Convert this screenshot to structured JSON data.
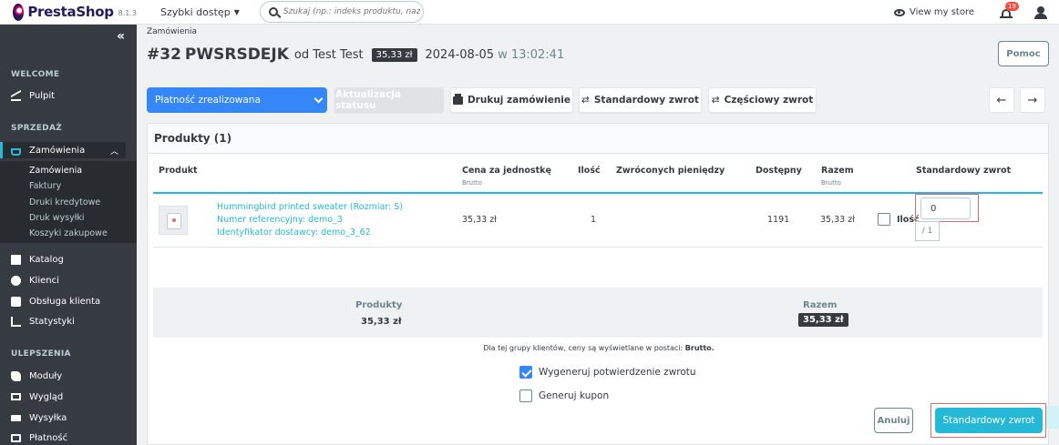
{
  "topbar": {
    "logo": "PrestaShop",
    "version": "8.1.3",
    "quick_access": "Szybki dostęp",
    "search_placeholder": "Szukaj (np.: indeks produktu, nazwa k",
    "view_store": "View my store",
    "notifications_count": "19"
  },
  "sidebar": {
    "collapse": "«",
    "sections": {
      "welcome": "WELCOME",
      "sales": "SPRZEDAŻ",
      "improvements": "ULEPSZENIA"
    },
    "items": {
      "dashboard": "Pulpit",
      "orders": "Zamówienia",
      "catalog": "Katalog",
      "customers": "Klienci",
      "service": "Obsługa klienta",
      "stats": "Statystyki",
      "modules": "Moduły",
      "design": "Wygląd",
      "shipping": "Wysyłka",
      "payment": "Płatność"
    },
    "orders_sub": [
      "Zamówienia",
      "Faktury",
      "Druki kredytowe",
      "Druk wysyłki",
      "Koszyki zakupowe"
    ]
  },
  "header": {
    "breadcrumb": "Zamówienia",
    "order_number": "#32",
    "order_ref": "PWSRSDEJK",
    "by_customer": "od Test Test",
    "total": "35,33 zł",
    "date": "2024-08-05",
    "time": "w 13:02:41",
    "help": "Pomoc"
  },
  "toolbar": {
    "status": "Płatność zrealizowana",
    "update_status": "Aktualizacja statusu",
    "print": "Drukuj zamówienie",
    "standard_refund": "Standardowy zwrot",
    "partial_refund": "Częściowy zwrot",
    "prev": "←",
    "next": "→"
  },
  "products": {
    "title": "Produkty (1)",
    "columns": {
      "product": "Produkt",
      "unit_price": "Cena za jednostkę",
      "unit_price_sub": "Brutto",
      "qty": "Ilość",
      "refunded": "Zwróconych pieniędzy",
      "available": "Dostępny",
      "total": "Razem",
      "total_sub": "Brutto",
      "standard_refund": "Standardowy zwrot"
    },
    "row": {
      "name": "Hummingbird printed sweater (Rozmiar: S)",
      "reference": "Numer referencyjny: demo_3",
      "supplier": "Identyfikator dostawcy: demo_3_62",
      "unit_price": "35,33 zł",
      "qty": "1",
      "available": "1191",
      "total": "35,33 zł",
      "qty_label": "Ilość",
      "refund_value": "0",
      "refund_of": "/ 1"
    }
  },
  "summary": {
    "products_label": "Produkty",
    "products_value": "35,33 zł",
    "total_label": "Razem",
    "total_value": "35,33 zł"
  },
  "note": {
    "text": "Dla tej grupy klientów, ceny są wyświetlane w postaci:",
    "strong": "Brutto."
  },
  "options": {
    "credit_slip": "Wygeneruj potwierdzenie zwrotu",
    "voucher": "Generuj kupon"
  },
  "actions": {
    "cancel": "Anuluj",
    "submit": "Standardowy zwrot"
  },
  "colors": {
    "primary": "#25b9d7",
    "status_blue": "#3586f6",
    "sidebar": "#363a41",
    "highlight_red": "#e06a6a"
  }
}
